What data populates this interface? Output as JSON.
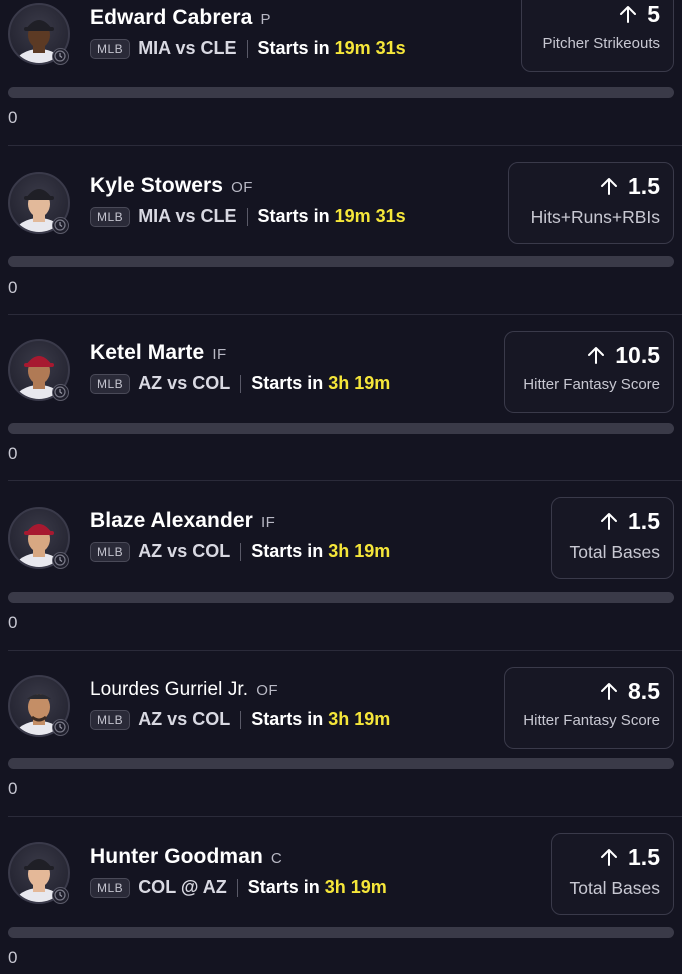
{
  "players": [
    {
      "name": "Edward Cabrera",
      "position": "P",
      "league": "MLB",
      "matchup": "MIA vs CLE",
      "starts_label": "Starts in",
      "starts_time": "19m 31s",
      "stat_value": "5",
      "stat_label": "Pitcher Strikeouts",
      "direction_icon": "arrow-up-icon",
      "cap_color": "#1f1f26",
      "progress": 0,
      "progress_count": "0"
    },
    {
      "name": "Kyle Stowers",
      "position": "OF",
      "league": "MLB",
      "matchup": "MIA vs CLE",
      "starts_label": "Starts in",
      "starts_time": "19m 31s",
      "stat_value": "1.5",
      "stat_label": "Hits+Runs+RBIs",
      "direction_icon": "arrow-up-icon",
      "cap_color": "#1f1f26",
      "progress": 0,
      "progress_count": "0"
    },
    {
      "name": "Ketel Marte",
      "position": "IF",
      "league": "MLB",
      "matchup": "AZ vs COL",
      "starts_label": "Starts in",
      "starts_time": "3h 19m",
      "stat_value": "10.5",
      "stat_label": "Hitter Fantasy Score",
      "direction_icon": "arrow-up-icon",
      "cap_color": "#a71930",
      "progress": 0,
      "progress_count": "0"
    },
    {
      "name": "Blaze Alexander",
      "position": "IF",
      "league": "MLB",
      "matchup": "AZ vs COL",
      "starts_label": "Starts in",
      "starts_time": "3h 19m",
      "stat_value": "1.5",
      "stat_label": "Total Bases",
      "direction_icon": "arrow-up-icon",
      "cap_color": "#a71930",
      "progress": 0,
      "progress_count": "0"
    },
    {
      "name": "Lourdes Gurriel Jr.",
      "position": "OF",
      "league": "MLB",
      "matchup": "AZ vs COL",
      "starts_label": "Starts in",
      "starts_time": "3h 19m",
      "stat_value": "8.5",
      "stat_label": "Hitter Fantasy Score",
      "direction_icon": "arrow-up-icon",
      "cap_color": "#2a2a30",
      "progress": 0,
      "progress_count": "0"
    },
    {
      "name": "Hunter Goodman",
      "position": "C",
      "league": "MLB",
      "matchup": "COL @ AZ",
      "starts_label": "Starts in",
      "starts_time": "3h 19m",
      "stat_value": "1.5",
      "stat_label": "Total Bases",
      "direction_icon": "arrow-up-icon",
      "cap_color": "#1f1f26",
      "progress": 0,
      "progress_count": "0"
    }
  ],
  "colors": {
    "background": "#141421",
    "countdown": "#f5e63a",
    "text": "#ffffff"
  }
}
